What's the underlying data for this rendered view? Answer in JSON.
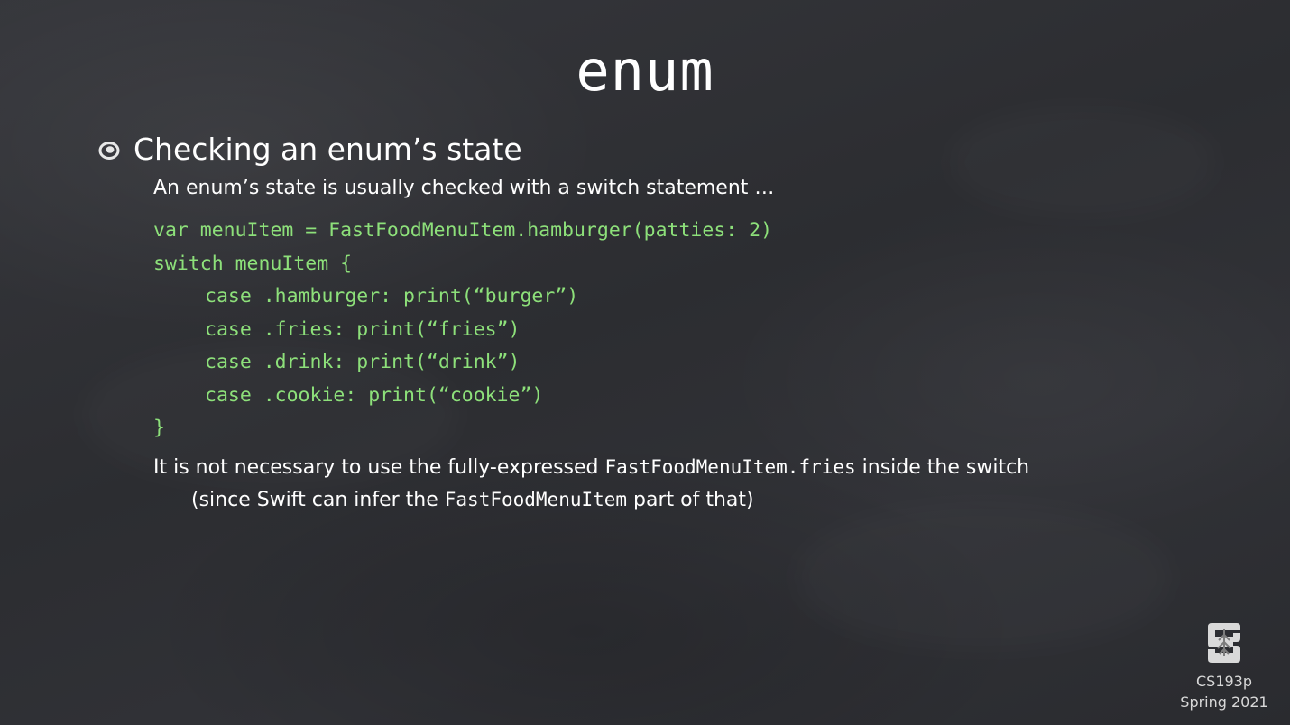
{
  "slide": {
    "title": "enum",
    "heading": "Checking an enum’s state",
    "subtext": "An enum’s state is usually checked with a switch statement …",
    "code_lines": [
      "var menuItem = FastFoodMenuItem.hamburger(patties: 2)",
      "switch menuItem {",
      "case .hamburger: print(“burger”)",
      "case .fries: print(“fries”)",
      "case .drink: print(“drink”)",
      "case .cookie: print(“cookie”)",
      "}"
    ],
    "note_line1": {
      "prefix": "It is not necessary to use the fully-expressed ",
      "code": "FastFoodMenuItem.fries",
      "suffix": " inside the switch"
    },
    "note_line2": {
      "prefix": "(since Swift can infer the ",
      "code": "FastFoodMenuItem",
      "suffix": " part of that)"
    },
    "course": "CS193p",
    "term": "Spring 2021"
  },
  "colors": {
    "background": "#2e2f33",
    "text": "#ffffff",
    "code": "#8de07a",
    "logo": "#d9d9d9"
  },
  "icons": {
    "bullet": "chalk-bullet-icon",
    "logo": "stanford-logo"
  }
}
